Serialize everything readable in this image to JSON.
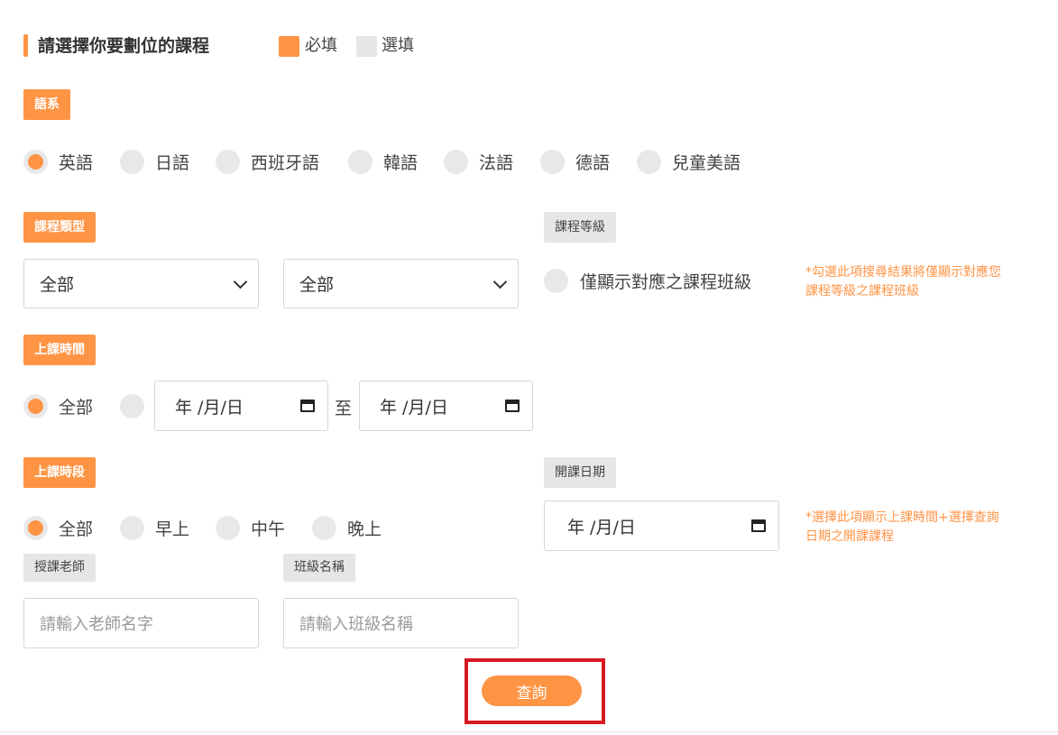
{
  "header": {
    "title": "請選擇你要劃位的課程",
    "legend": {
      "required_label": "必填",
      "optional_label": "選填",
      "required_color": "#ff9445",
      "optional_color": "#e6e6e6"
    }
  },
  "language": {
    "tag": "語系",
    "options": [
      "英語",
      "日語",
      "西班牙語",
      "韓語",
      "法語",
      "德語",
      "兒童美語"
    ],
    "selected": "英語"
  },
  "course_type": {
    "tag": "課程類型",
    "select1_value": "全部",
    "select2_value": "全部"
  },
  "course_level": {
    "tag": "課程等級",
    "checkbox_label": "僅顯示對應之課程班級",
    "note_line1": "*勾選此項搜尋結果將僅顯示對應您",
    "note_line2": "課程等級之課程班級"
  },
  "class_time": {
    "tag": "上課時間",
    "all_label": "全部",
    "date_from": "年 /月/日",
    "separator": "至",
    "date_to": "年 /月/日"
  },
  "time_slot": {
    "tag": "上課時段",
    "options": [
      "全部",
      "早上",
      "中午",
      "晚上"
    ],
    "selected": "全部"
  },
  "start_date": {
    "tag": "開課日期",
    "date_value": "年 /月/日",
    "note_line1": "*選擇此項顯示上課時間+選擇查詢",
    "note_line2": "日期之開課課程"
  },
  "teacher": {
    "tag": "授課老師",
    "placeholder": "請輸入老師名字"
  },
  "class_name": {
    "tag": "班級名稱",
    "placeholder": "請輸入班級名稱"
  },
  "search_button_label": "查詢",
  "accent_color": "#ff9445",
  "highlight_color": "#d71920"
}
